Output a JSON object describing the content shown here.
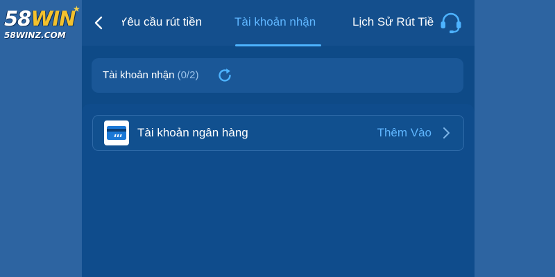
{
  "brand": {
    "logo_prefix": "58",
    "logo_suffix": "WIN",
    "domain": "58WINZ.COM"
  },
  "header": {
    "tabs": [
      {
        "label": "Yêu cầu rút tiền",
        "active": false
      },
      {
        "label": "Tài khoản nhận",
        "active": true
      },
      {
        "label": "Lịch Sử Rút Tiền",
        "active": false
      }
    ]
  },
  "accounts": {
    "label": "Tài khoản nhận",
    "count": "(0/2)"
  },
  "bank": {
    "label": "Tài khoản ngân hàng",
    "action_label": "Thêm Vào"
  },
  "icons": {
    "back": "chevron-left-icon",
    "support": "headset-icon",
    "refresh": "refresh-icon",
    "bank": "credit-card-icon",
    "next": "chevron-right-icon"
  },
  "colors": {
    "accent": "#4db3ff",
    "background": "#0e4a87",
    "brand_gold": "#f3c12d"
  }
}
